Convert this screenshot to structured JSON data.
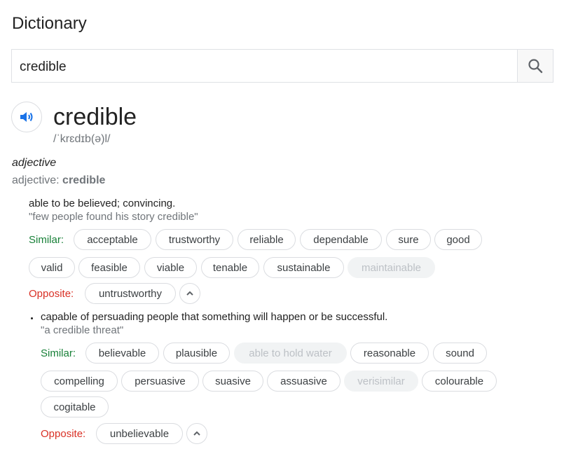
{
  "page_title": "Dictionary",
  "search": {
    "query": "credible"
  },
  "entry": {
    "word": "credible",
    "phonetic": "/ˈkrɛdɪb(ə)l/",
    "part_of_speech": "adjective",
    "inflection_prefix": "adjective: ",
    "inflection_word": "credible"
  },
  "labels": {
    "similar": "Similar:",
    "opposite": "Opposite:"
  },
  "senses": [
    {
      "definition": "able to be believed; convincing.",
      "example": "\"few people found his story credible\"",
      "similar": [
        "acceptable",
        "trustworthy",
        "reliable",
        "dependable",
        "sure",
        "good",
        "valid",
        "feasible",
        "viable",
        "tenable",
        "sustainable",
        "maintainable"
      ],
      "opposite": [
        "untrustworthy"
      ]
    },
    {
      "definition": "capable of persuading people that something will happen or be successful.",
      "example": "\"a credible threat\"",
      "similar": [
        "believable",
        "plausible",
        "able to hold water",
        "reasonable",
        "sound",
        "compelling",
        "persuasive",
        "suasive",
        "assuasive",
        "verisimilar",
        "colourable",
        "cogitable"
      ],
      "opposite": [
        "unbelievable"
      ]
    }
  ],
  "icons": {
    "search": "search-icon",
    "speaker": "speaker-icon",
    "collapse": "chevron-up-icon"
  },
  "colors": {
    "similar_label": "#188038",
    "opposite_label": "#d93025",
    "accent": "#1a73e8"
  }
}
